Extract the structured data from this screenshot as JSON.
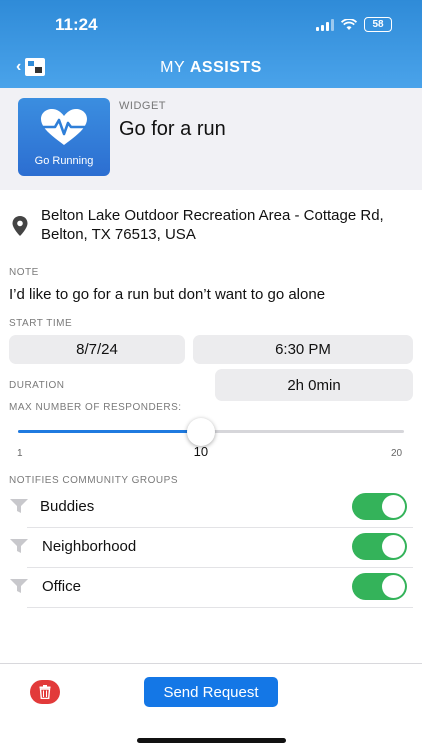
{
  "status": {
    "time": "11:24",
    "battery": "58"
  },
  "header": {
    "title_prefix": "MY",
    "title_bold": "ASSISTS"
  },
  "widget": {
    "caption": "WIDGET",
    "tile_label": "Go Running",
    "name": "Go for a run"
  },
  "location": {
    "address": "Belton Lake Outdoor Recreation Area - Cottage Rd, Belton, TX 76513, USA"
  },
  "note": {
    "label": "NOTE",
    "text": "I’d like to go for a run but don’t want to go alone"
  },
  "start": {
    "label": "START TIME",
    "date": "8/7/24",
    "time": "6:30 PM"
  },
  "duration": {
    "label": "DURATION",
    "value": "2h 0min"
  },
  "responders": {
    "label": "MAX NUMBER OF RESPONDERS:",
    "min": "1",
    "max": "20",
    "value": "10"
  },
  "groups": {
    "label": "NOTIFIES COMMUNITY GROUPS",
    "items": [
      {
        "name": "Buddies",
        "enabled": true
      },
      {
        "name": "Neighborhood",
        "enabled": true
      },
      {
        "name": "Office",
        "enabled": true
      }
    ]
  },
  "actions": {
    "send_label": "Send Request"
  },
  "colors": {
    "header": "#2f8bd8",
    "accent": "#1477e6",
    "toggle_on": "#34b35a",
    "delete": "#e23a3a"
  },
  "icons": [
    "back-chevron-icon",
    "app-logo-icon",
    "heart-pulse-icon",
    "location-pin-icon",
    "funnel-icon",
    "trash-icon"
  ]
}
